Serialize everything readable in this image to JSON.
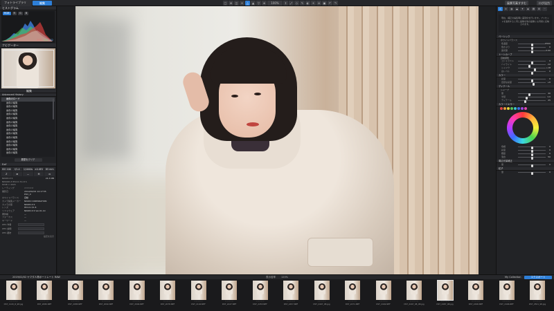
{
  "topbar": {
    "tab_library": "フォトライブラリ",
    "tab_edit": "編集",
    "tools": [
      "□",
      "⊞",
      "◫",
      "✕",
      "△",
      "▲",
      "▽",
      "⊕",
      "↕",
      "⤢",
      "◇",
      "✎",
      "◐",
      "⚭",
      "⊘",
      "▣"
    ],
    "zoom_label": "100%",
    "tools_b": [
      "↶",
      "↷"
    ],
    "right_a": "風景写真すすむ",
    "right_b": "ログ出力"
  },
  "left": {
    "histogram_title": "ヒストグラム",
    "histogram_tabs": [
      "RGB",
      "R",
      "G",
      "B"
    ],
    "histogram_values": {
      "r": "255",
      "g": "164",
      "b": "82"
    },
    "navigator_title": "ナビゲーター",
    "edit_title": "編集",
    "history_title": "Advanced History",
    "history_items": [
      "画像のロード",
      "画像の編集",
      "画像の編集",
      "画像の編集",
      "画像の編集",
      "画像の編集",
      "画像の編集",
      "画像の編集",
      "画像の編集",
      "画像の編集",
      "画像の編集",
      "画像の編集",
      "画像の編集",
      "画像の編集",
      "画像の編集"
    ],
    "history_button": "履歴をクリア",
    "exif_title": "Exif",
    "exif_cells": [
      "ISO 100",
      "f/1.4",
      "1/1000s",
      "±0.0EV",
      "85 mm"
    ],
    "exif_cells2": [
      "Z",
      "⊞",
      "—",
      "M",
      "⊡"
    ],
    "camera_model": "NIKON Z 6",
    "lens": "NIKKOR Z 85mm f/1.8 S",
    "dimensions": "6048 × 4024",
    "file_size": "24.3 MB",
    "kv": [
      {
        "k": "レーティング",
        "v": "☆☆☆☆☆"
      },
      {
        "k": "撮影日",
        "v": "2019/02/02 14:17:55"
      },
      {
        "k": "",
        "v": "DSC_0"
      },
      {
        "k": "ホワイトバランス",
        "v": "自動"
      },
      {
        "k": "カメラ製造メーカー",
        "v": "NIKON CORPORATION"
      },
      {
        "k": "カメラの型",
        "v": "NIKON Z 6"
      },
      {
        "k": "レンズ",
        "v": "85mm f/1.8"
      },
      {
        "k": "ソフトウェア",
        "v": "NIKON Z 6 Ver.01.10"
      },
      {
        "k": "著作権",
        "v": "—"
      },
      {
        "k": "フォーカス",
        "v": "—"
      },
      {
        "k": "キーワード",
        "v": "—"
      }
    ],
    "ratings": [
      "IPTC 作者",
      "IPTC 説明",
      "IPTC 都市"
    ],
    "footer": "設定を表示"
  },
  "right": {
    "icons": [
      "⌂",
      "⊙",
      "◑",
      "◒",
      "✦",
      "◈",
      "▤",
      "⚙",
      "⋯"
    ],
    "notice": "現在、補正の編集時に差別化を行います。プリセットを適用すると同じ画像を他の画像にも同様に反映されます。",
    "sections": [
      {
        "title": "ベーシック",
        "sub": "ホワイトバランス",
        "sliders": [
          {
            "label": "色温度",
            "value": "5500",
            "pos": 0.5
          },
          {
            "label": "色かぶり",
            "value": "0",
            "pos": 0.5
          },
          {
            "label": "露光量",
            "value": "0.00",
            "pos": 0.5
          }
        ]
      },
      {
        "title": "トーンカーブ",
        "sub": "自動調整",
        "sliders": [
          {
            "label": "コントラスト",
            "value": "0",
            "pos": 0.5
          },
          {
            "label": "ハイライト",
            "value": "-12",
            "pos": 0.42
          },
          {
            "label": "シャドウ",
            "value": "+18",
            "pos": 0.62
          },
          {
            "label": "白レベル",
            "value": "0",
            "pos": 0.5
          }
        ]
      },
      {
        "title": "カラー",
        "sub": "",
        "sliders": [
          {
            "label": "彩度",
            "value": "0",
            "pos": 0.5
          },
          {
            "label": "自然な彩度",
            "value": "+6",
            "pos": 0.55
          }
        ]
      },
      {
        "title": "ディテール",
        "sub": "シャープ",
        "sliders": [
          {
            "label": "量",
            "value": "40",
            "pos": 0.4
          },
          {
            "label": "半径",
            "value": "1.0",
            "pos": 0.3
          },
          {
            "label": "ディテール",
            "value": "25",
            "pos": 0.25
          }
        ]
      }
    ],
    "color_title": "カラーミキサー",
    "swatch_colors": [
      "#e04646",
      "#e89a3a",
      "#e3d53a",
      "#59c25a",
      "#39c3cf",
      "#3a6ee6",
      "#9b47e0",
      "#e046ab"
    ],
    "after_wheel": [
      {
        "label": "色相",
        "value": "0",
        "pos": 0.5
      },
      {
        "label": "彩度",
        "value": "0",
        "pos": 0.5
      },
      {
        "label": "輝度",
        "value": "0",
        "pos": 0.5
      },
      {
        "label": "混合",
        "value": "50",
        "pos": 0.5
      }
    ],
    "vignette_title": "周辺光量補正",
    "vignette_sliders": [
      {
        "label": "量",
        "value": "0",
        "pos": 0.5
      }
    ],
    "grain_title": "粒子",
    "grain_sliders": [
      {
        "label": "量",
        "value": "0",
        "pos": 0.5
      }
    ]
  },
  "filmbar": {
    "path": "2019/02/02 ヤマダ人物ポートレート RAW",
    "zoom_label": "表示倍率",
    "zoom_value": "120%",
    "collection": "My Collection",
    "export": "エクスポート"
  },
  "filmstrip": [
    {
      "name": "DST_1120_R_98.jpg",
      "selected": false
    },
    {
      "name": "DST_2080.NEF",
      "selected": false
    },
    {
      "name": "DST_2085.NEF",
      "selected": false
    },
    {
      "name": "DST_2090.NEF",
      "selected": false
    },
    {
      "name": "DST_2094.NEF",
      "selected": false
    },
    {
      "name": "DST_2078.NEF",
      "selected": false
    },
    {
      "name": "DST_2140.NEF",
      "selected": false
    },
    {
      "name": "DST_2447.NEF",
      "selected": false
    },
    {
      "name": "DST_2453.NEF",
      "selected": false
    },
    {
      "name": "DST_2457.NEF",
      "selected": false
    },
    {
      "name": "DST_2497_98.jpg",
      "selected": false
    },
    {
      "name": "DST_2471.NEF",
      "selected": false
    },
    {
      "name": "DST_2492.NEF",
      "selected": false
    },
    {
      "name": "DST_2497_98_98.jpg",
      "selected": false
    },
    {
      "name": "DST_2487_98.jpg",
      "selected": true
    },
    {
      "name": "DST_2498.NEF",
      "selected": false
    },
    {
      "name": "DST_2496.NEF",
      "selected": false
    },
    {
      "name": "DST_2501_98.jpg",
      "selected": false
    },
    {
      "name": "DST_2502.NEF",
      "selected": false
    }
  ],
  "stars": "☆☆☆☆☆"
}
